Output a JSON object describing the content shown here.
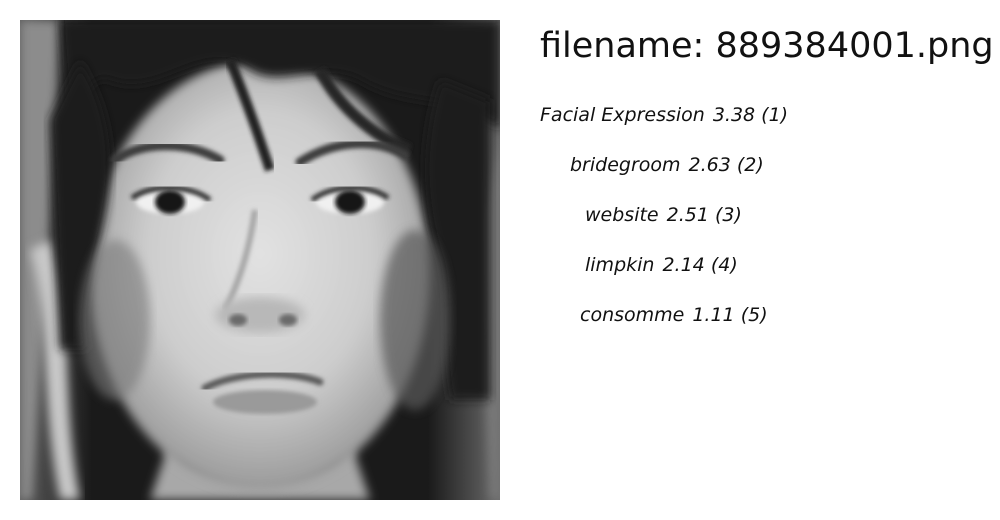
{
  "filename_label": "filename: 889384001.png",
  "predictions": [
    {
      "label": "Facial Expression",
      "score": "3.38",
      "rank": "(1)"
    },
    {
      "label": "bridegroom",
      "score": "2.63",
      "rank": "(2)"
    },
    {
      "label": "website",
      "score": "2.51",
      "rank": "(3)"
    },
    {
      "label": "limpkin",
      "score": "2.14",
      "rank": "(4)"
    },
    {
      "label": "consomme",
      "score": "1.11",
      "rank": "(5)"
    }
  ],
  "image": {
    "subject": "grayscale close-up face photo",
    "colors": {
      "hair": "#1e1e1e",
      "skin": "#cfcfcf",
      "shadow": "#8a8a8a"
    }
  }
}
